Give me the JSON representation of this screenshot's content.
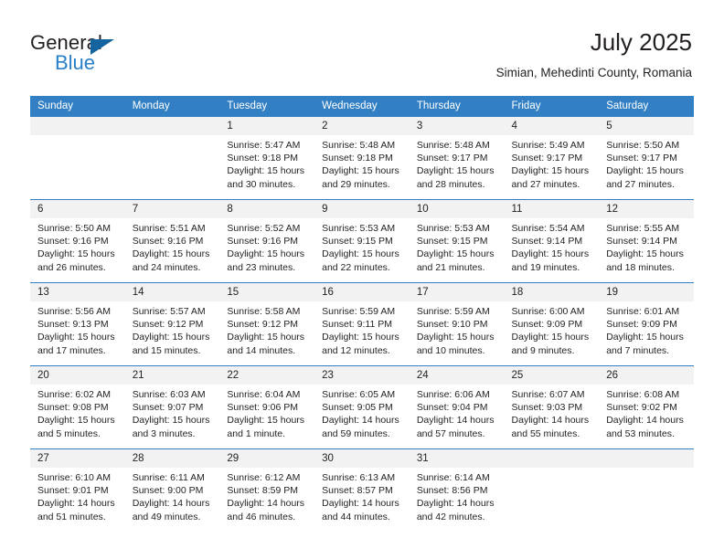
{
  "brand": {
    "name_part1": "General",
    "name_part2": "Blue",
    "triangle_icon": "brand-triangle-icon",
    "accent_color": "#2a7fc9"
  },
  "header": {
    "title": "July 2025",
    "subtitle": "Simian, Mehedinti County, Romania"
  },
  "theme": {
    "header_blue": "#3280c3",
    "daynum_band": "#f2f2f2",
    "text": "#231f20"
  },
  "calendar": {
    "weekday_headers": [
      "Sunday",
      "Monday",
      "Tuesday",
      "Wednesday",
      "Thursday",
      "Friday",
      "Saturday"
    ],
    "weeks": [
      [
        {
          "day": "",
          "blank": true,
          "sunrise": "",
          "sunset": "",
          "daylight1": "",
          "daylight2": ""
        },
        {
          "day": "",
          "blank": true,
          "sunrise": "",
          "sunset": "",
          "daylight1": "",
          "daylight2": ""
        },
        {
          "day": "1",
          "blank": false,
          "sunrise": "Sunrise: 5:47 AM",
          "sunset": "Sunset: 9:18 PM",
          "daylight1": "Daylight: 15 hours",
          "daylight2": "and 30 minutes."
        },
        {
          "day": "2",
          "blank": false,
          "sunrise": "Sunrise: 5:48 AM",
          "sunset": "Sunset: 9:18 PM",
          "daylight1": "Daylight: 15 hours",
          "daylight2": "and 29 minutes."
        },
        {
          "day": "3",
          "blank": false,
          "sunrise": "Sunrise: 5:48 AM",
          "sunset": "Sunset: 9:17 PM",
          "daylight1": "Daylight: 15 hours",
          "daylight2": "and 28 minutes."
        },
        {
          "day": "4",
          "blank": false,
          "sunrise": "Sunrise: 5:49 AM",
          "sunset": "Sunset: 9:17 PM",
          "daylight1": "Daylight: 15 hours",
          "daylight2": "and 27 minutes."
        },
        {
          "day": "5",
          "blank": false,
          "sunrise": "Sunrise: 5:50 AM",
          "sunset": "Sunset: 9:17 PM",
          "daylight1": "Daylight: 15 hours",
          "daylight2": "and 27 minutes."
        }
      ],
      [
        {
          "day": "6",
          "blank": false,
          "sunrise": "Sunrise: 5:50 AM",
          "sunset": "Sunset: 9:16 PM",
          "daylight1": "Daylight: 15 hours",
          "daylight2": "and 26 minutes."
        },
        {
          "day": "7",
          "blank": false,
          "sunrise": "Sunrise: 5:51 AM",
          "sunset": "Sunset: 9:16 PM",
          "daylight1": "Daylight: 15 hours",
          "daylight2": "and 24 minutes."
        },
        {
          "day": "8",
          "blank": false,
          "sunrise": "Sunrise: 5:52 AM",
          "sunset": "Sunset: 9:16 PM",
          "daylight1": "Daylight: 15 hours",
          "daylight2": "and 23 minutes."
        },
        {
          "day": "9",
          "blank": false,
          "sunrise": "Sunrise: 5:53 AM",
          "sunset": "Sunset: 9:15 PM",
          "daylight1": "Daylight: 15 hours",
          "daylight2": "and 22 minutes."
        },
        {
          "day": "10",
          "blank": false,
          "sunrise": "Sunrise: 5:53 AM",
          "sunset": "Sunset: 9:15 PM",
          "daylight1": "Daylight: 15 hours",
          "daylight2": "and 21 minutes."
        },
        {
          "day": "11",
          "blank": false,
          "sunrise": "Sunrise: 5:54 AM",
          "sunset": "Sunset: 9:14 PM",
          "daylight1": "Daylight: 15 hours",
          "daylight2": "and 19 minutes."
        },
        {
          "day": "12",
          "blank": false,
          "sunrise": "Sunrise: 5:55 AM",
          "sunset": "Sunset: 9:14 PM",
          "daylight1": "Daylight: 15 hours",
          "daylight2": "and 18 minutes."
        }
      ],
      [
        {
          "day": "13",
          "blank": false,
          "sunrise": "Sunrise: 5:56 AM",
          "sunset": "Sunset: 9:13 PM",
          "daylight1": "Daylight: 15 hours",
          "daylight2": "and 17 minutes."
        },
        {
          "day": "14",
          "blank": false,
          "sunrise": "Sunrise: 5:57 AM",
          "sunset": "Sunset: 9:12 PM",
          "daylight1": "Daylight: 15 hours",
          "daylight2": "and 15 minutes."
        },
        {
          "day": "15",
          "blank": false,
          "sunrise": "Sunrise: 5:58 AM",
          "sunset": "Sunset: 9:12 PM",
          "daylight1": "Daylight: 15 hours",
          "daylight2": "and 14 minutes."
        },
        {
          "day": "16",
          "blank": false,
          "sunrise": "Sunrise: 5:59 AM",
          "sunset": "Sunset: 9:11 PM",
          "daylight1": "Daylight: 15 hours",
          "daylight2": "and 12 minutes."
        },
        {
          "day": "17",
          "blank": false,
          "sunrise": "Sunrise: 5:59 AM",
          "sunset": "Sunset: 9:10 PM",
          "daylight1": "Daylight: 15 hours",
          "daylight2": "and 10 minutes."
        },
        {
          "day": "18",
          "blank": false,
          "sunrise": "Sunrise: 6:00 AM",
          "sunset": "Sunset: 9:09 PM",
          "daylight1": "Daylight: 15 hours",
          "daylight2": "and 9 minutes."
        },
        {
          "day": "19",
          "blank": false,
          "sunrise": "Sunrise: 6:01 AM",
          "sunset": "Sunset: 9:09 PM",
          "daylight1": "Daylight: 15 hours",
          "daylight2": "and 7 minutes."
        }
      ],
      [
        {
          "day": "20",
          "blank": false,
          "sunrise": "Sunrise: 6:02 AM",
          "sunset": "Sunset: 9:08 PM",
          "daylight1": "Daylight: 15 hours",
          "daylight2": "and 5 minutes."
        },
        {
          "day": "21",
          "blank": false,
          "sunrise": "Sunrise: 6:03 AM",
          "sunset": "Sunset: 9:07 PM",
          "daylight1": "Daylight: 15 hours",
          "daylight2": "and 3 minutes."
        },
        {
          "day": "22",
          "blank": false,
          "sunrise": "Sunrise: 6:04 AM",
          "sunset": "Sunset: 9:06 PM",
          "daylight1": "Daylight: 15 hours",
          "daylight2": "and 1 minute."
        },
        {
          "day": "23",
          "blank": false,
          "sunrise": "Sunrise: 6:05 AM",
          "sunset": "Sunset: 9:05 PM",
          "daylight1": "Daylight: 14 hours",
          "daylight2": "and 59 minutes."
        },
        {
          "day": "24",
          "blank": false,
          "sunrise": "Sunrise: 6:06 AM",
          "sunset": "Sunset: 9:04 PM",
          "daylight1": "Daylight: 14 hours",
          "daylight2": "and 57 minutes."
        },
        {
          "day": "25",
          "blank": false,
          "sunrise": "Sunrise: 6:07 AM",
          "sunset": "Sunset: 9:03 PM",
          "daylight1": "Daylight: 14 hours",
          "daylight2": "and 55 minutes."
        },
        {
          "day": "26",
          "blank": false,
          "sunrise": "Sunrise: 6:08 AM",
          "sunset": "Sunset: 9:02 PM",
          "daylight1": "Daylight: 14 hours",
          "daylight2": "and 53 minutes."
        }
      ],
      [
        {
          "day": "27",
          "blank": false,
          "sunrise": "Sunrise: 6:10 AM",
          "sunset": "Sunset: 9:01 PM",
          "daylight1": "Daylight: 14 hours",
          "daylight2": "and 51 minutes."
        },
        {
          "day": "28",
          "blank": false,
          "sunrise": "Sunrise: 6:11 AM",
          "sunset": "Sunset: 9:00 PM",
          "daylight1": "Daylight: 14 hours",
          "daylight2": "and 49 minutes."
        },
        {
          "day": "29",
          "blank": false,
          "sunrise": "Sunrise: 6:12 AM",
          "sunset": "Sunset: 8:59 PM",
          "daylight1": "Daylight: 14 hours",
          "daylight2": "and 46 minutes."
        },
        {
          "day": "30",
          "blank": false,
          "sunrise": "Sunrise: 6:13 AM",
          "sunset": "Sunset: 8:57 PM",
          "daylight1": "Daylight: 14 hours",
          "daylight2": "and 44 minutes."
        },
        {
          "day": "31",
          "blank": false,
          "sunrise": "Sunrise: 6:14 AM",
          "sunset": "Sunset: 8:56 PM",
          "daylight1": "Daylight: 14 hours",
          "daylight2": "and 42 minutes."
        },
        {
          "day": "",
          "blank": true,
          "sunrise": "",
          "sunset": "",
          "daylight1": "",
          "daylight2": ""
        },
        {
          "day": "",
          "blank": true,
          "sunrise": "",
          "sunset": "",
          "daylight1": "",
          "daylight2": ""
        }
      ]
    ]
  }
}
